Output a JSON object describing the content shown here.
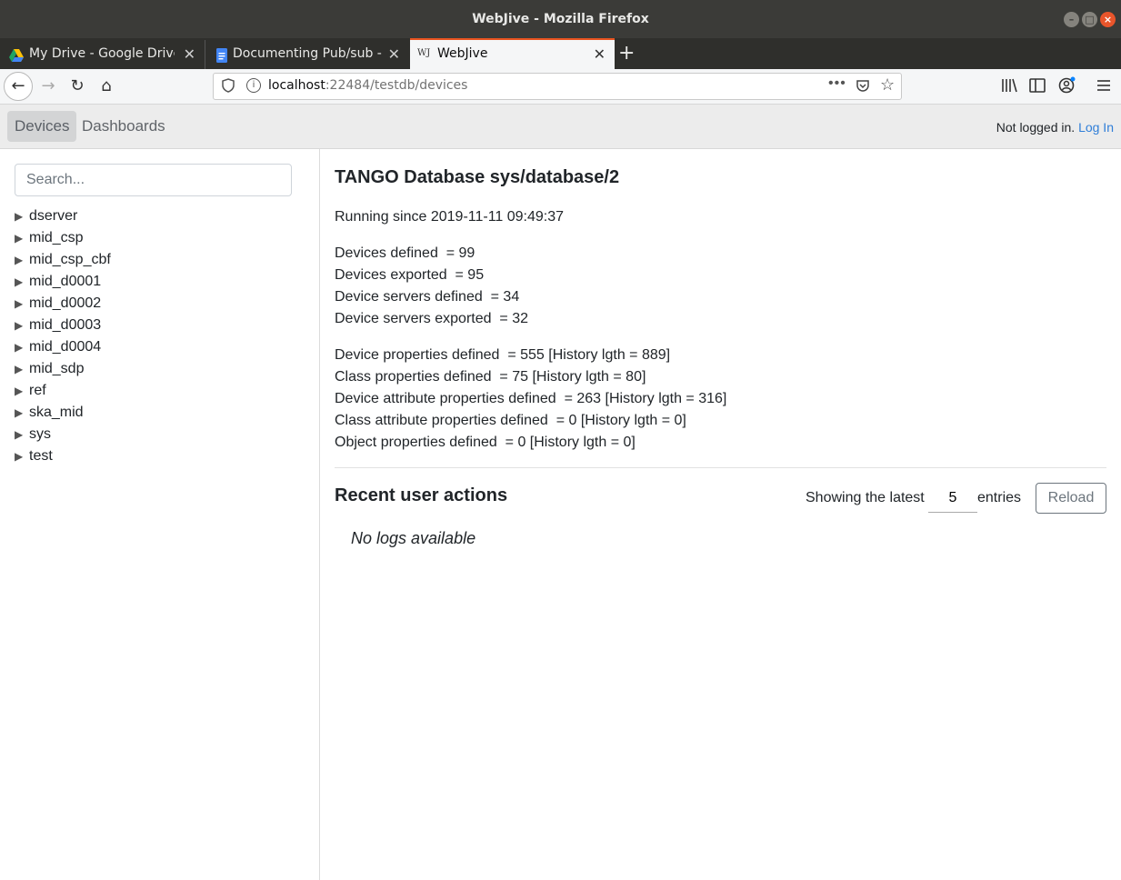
{
  "window": {
    "title": "WebJive - Mozilla Firefox"
  },
  "tabs": [
    {
      "label": "My Drive - Google Drive"
    },
    {
      "label": "Documenting Pub/sub - G"
    },
    {
      "label": "WebJive",
      "icon_text": "WJ"
    }
  ],
  "navbar": {
    "url_host": "localhost",
    "url_rest": ":22484/testdb/devices"
  },
  "app_header": {
    "nav": [
      "Devices",
      "Dashboards"
    ],
    "login_status": "Not logged in.",
    "login_link": "Log In"
  },
  "sidebar": {
    "search_placeholder": "Search...",
    "arrow": "▶",
    "items": [
      "dserver",
      "mid_csp",
      "mid_csp_cbf",
      "mid_d0001",
      "mid_d0002",
      "mid_d0003",
      "mid_d0004",
      "mid_sdp",
      "ref",
      "ska_mid",
      "sys",
      "test"
    ]
  },
  "main": {
    "title": "TANGO Database sys/database/2",
    "running_since": "Running since 2019-11-11 09:49:37",
    "stats_group1": [
      "Devices defined  = 99",
      "Devices exported  = 95",
      "Device servers defined  = 34",
      "Device servers exported  = 32"
    ],
    "stats_group2": [
      "Device properties defined  = 555 [History lgth = 889]",
      "Class properties defined  = 75 [History lgth = 80]",
      "Device attribute properties defined  = 263 [History lgth = 316]",
      "Class attribute properties defined  = 0 [History lgth = 0]",
      "Object properties defined  = 0 [History lgth = 0]"
    ],
    "recent_title": "Recent user actions",
    "showing_label": "Showing the latest",
    "entries_value": "5",
    "entries_label": "entries",
    "reload_label": "Reload",
    "no_logs": "No logs available"
  },
  "colors": {
    "accent": "#e95420",
    "link": "#2f7ed8"
  }
}
